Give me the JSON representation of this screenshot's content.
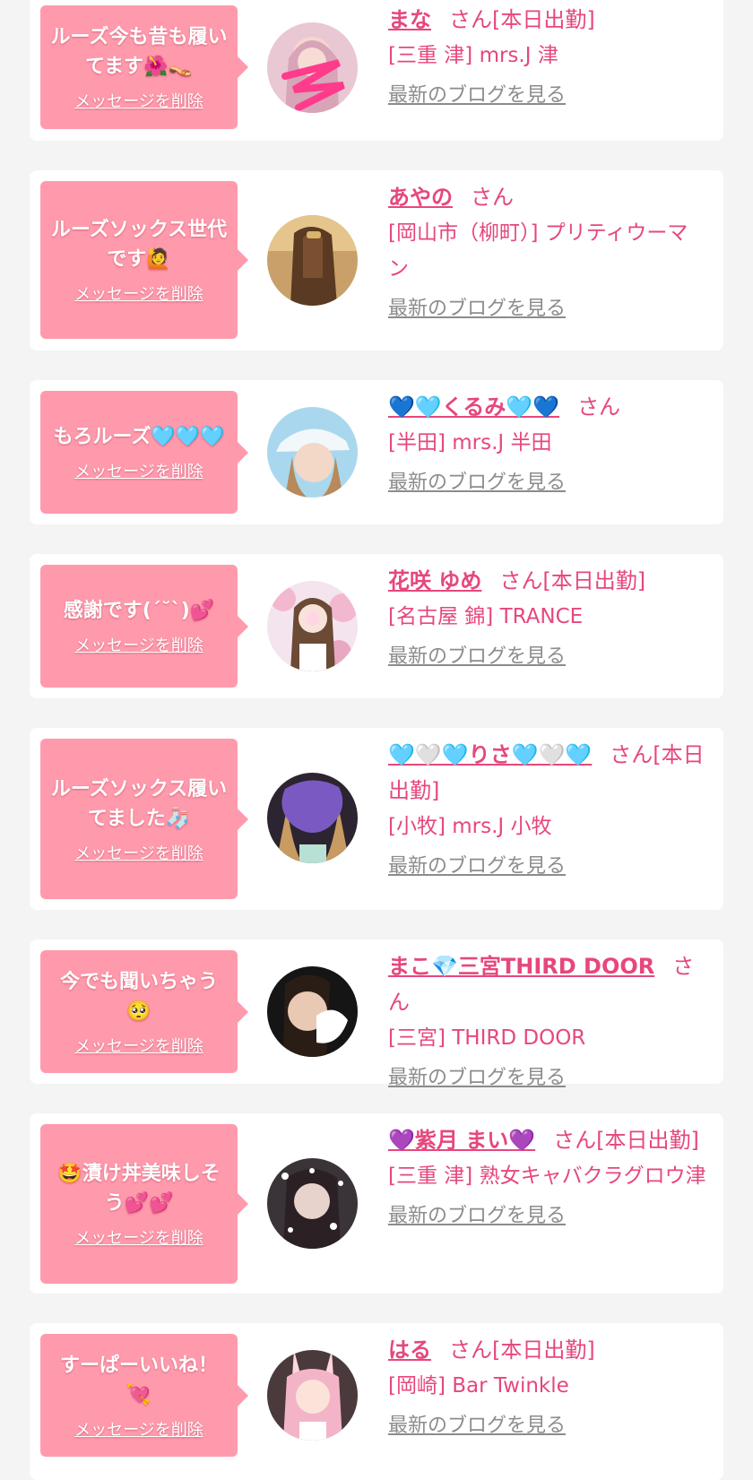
{
  "colors": {
    "page_bg": "#f4f4f4",
    "card_bg": "#ffffff",
    "bubble_bg": "#ff9aac",
    "name_color": "#e6477d",
    "blog_link_color": "#8c8c8c"
  },
  "entries": [
    {
      "message": "ルーズ今も昔も履いてます🌺👡",
      "delete_label": "メッセージを削除",
      "name": "まな",
      "san": "さん[本日出勤]",
      "shop": "[三重 津] mrs.J 津",
      "blog_link": "最新のブログを見る",
      "avatar_icon": "avatar-photo-pink"
    },
    {
      "message": "ルーズソックス世代です🙋",
      "delete_label": "メッセージを削除",
      "name": "あやの",
      "san": "さん",
      "shop": "[岡山市（柳町）] プリティウーマン",
      "blog_link": "最新のブログを見る",
      "avatar_icon": "avatar-photo-hair"
    },
    {
      "message": "もろルーズ🩵🩵🩵",
      "delete_label": "メッセージを削除",
      "name": "💙🩵くるみ🩵💙",
      "san": "さん",
      "shop": "[半田] mrs.J 半田",
      "blog_link": "最新のブログを見る",
      "avatar_icon": "avatar-photo-cap"
    },
    {
      "message": "感謝です(ˊ˘ˋ)💕",
      "delete_label": "メッセージを削除",
      "name": "花咲 ゆめ",
      "san": "さん[本日出勤]",
      "shop": "[名古屋 錦] TRANCE",
      "blog_link": "最新のブログを見る",
      "avatar_icon": "avatar-photo-blossom"
    },
    {
      "message": "ルーズソックス履いてました🧦",
      "delete_label": "メッセージを削除",
      "name": "🩵🤍🩵りさ🩵🤍🩵",
      "san": "さん[本日出勤]",
      "shop": "[小牧] mrs.J 小牧",
      "blog_link": "最新のブログを見る",
      "avatar_icon": "avatar-photo-purple"
    },
    {
      "message": "今でも聞いちゃう🥺",
      "delete_label": "メッセージを削除",
      "name": "まこ💎三宮THIRD DOOR",
      "san": "さん",
      "shop": "[三宮] THIRD DOOR",
      "blog_link": "最新のブログを見る",
      "avatar_icon": "avatar-photo-dark"
    },
    {
      "message": "🤩漬け丼美味しそう💕💕",
      "delete_label": "メッセージを削除",
      "name": "💜紫月 まい💜",
      "san": "さん[本日出勤]",
      "shop": "[三重 津] 熟女キャバクラグロウ津",
      "blog_link": "最新のブログを見る",
      "avatar_icon": "avatar-photo-sparkle"
    },
    {
      "message": "すーぱーいいね！💘",
      "delete_label": "メッセージを削除",
      "name": "はる",
      "san": "さん[本日出勤]",
      "shop": "[岡崎] Bar Twinkle",
      "blog_link": "最新のブログを見る",
      "avatar_icon": "avatar-photo-bunny"
    }
  ]
}
